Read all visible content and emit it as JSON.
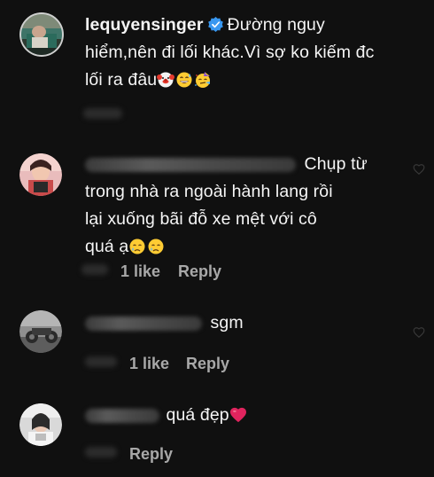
{
  "comments": [
    {
      "username": "lequyensinger",
      "verified": true,
      "text_line1": "Đường nguy",
      "text_line2": "hiểm,nên đi lối khác.Vì sợ ko kiếm đc",
      "text_line3": "lối ra đâu",
      "emojis": [
        "clown-face",
        "grinning-sweat",
        "partying-face"
      ]
    },
    {
      "username": "",
      "text_line1": "Chụp từ",
      "text_line2": "trong nhà ra ngoài hành lang rồi",
      "text_line3": "lại xuống bãi đỗ xe mệt với cô",
      "text_line4": "quá ạ",
      "emojis": [
        "crying-face",
        "crying-face"
      ],
      "likes": "1 like",
      "reply": "Reply"
    },
    {
      "username": "",
      "text": "sgm",
      "likes": "1 like",
      "reply": "Reply"
    },
    {
      "username": "",
      "text": "quá đẹp",
      "emojis": [
        "red-heart"
      ],
      "reply": "Reply"
    }
  ],
  "colors": {
    "background": "#101010",
    "primary_text": "#f5f5f5",
    "secondary_text": "#a8a8a8",
    "verified": "#3897f0",
    "heart": "#e0245e"
  }
}
